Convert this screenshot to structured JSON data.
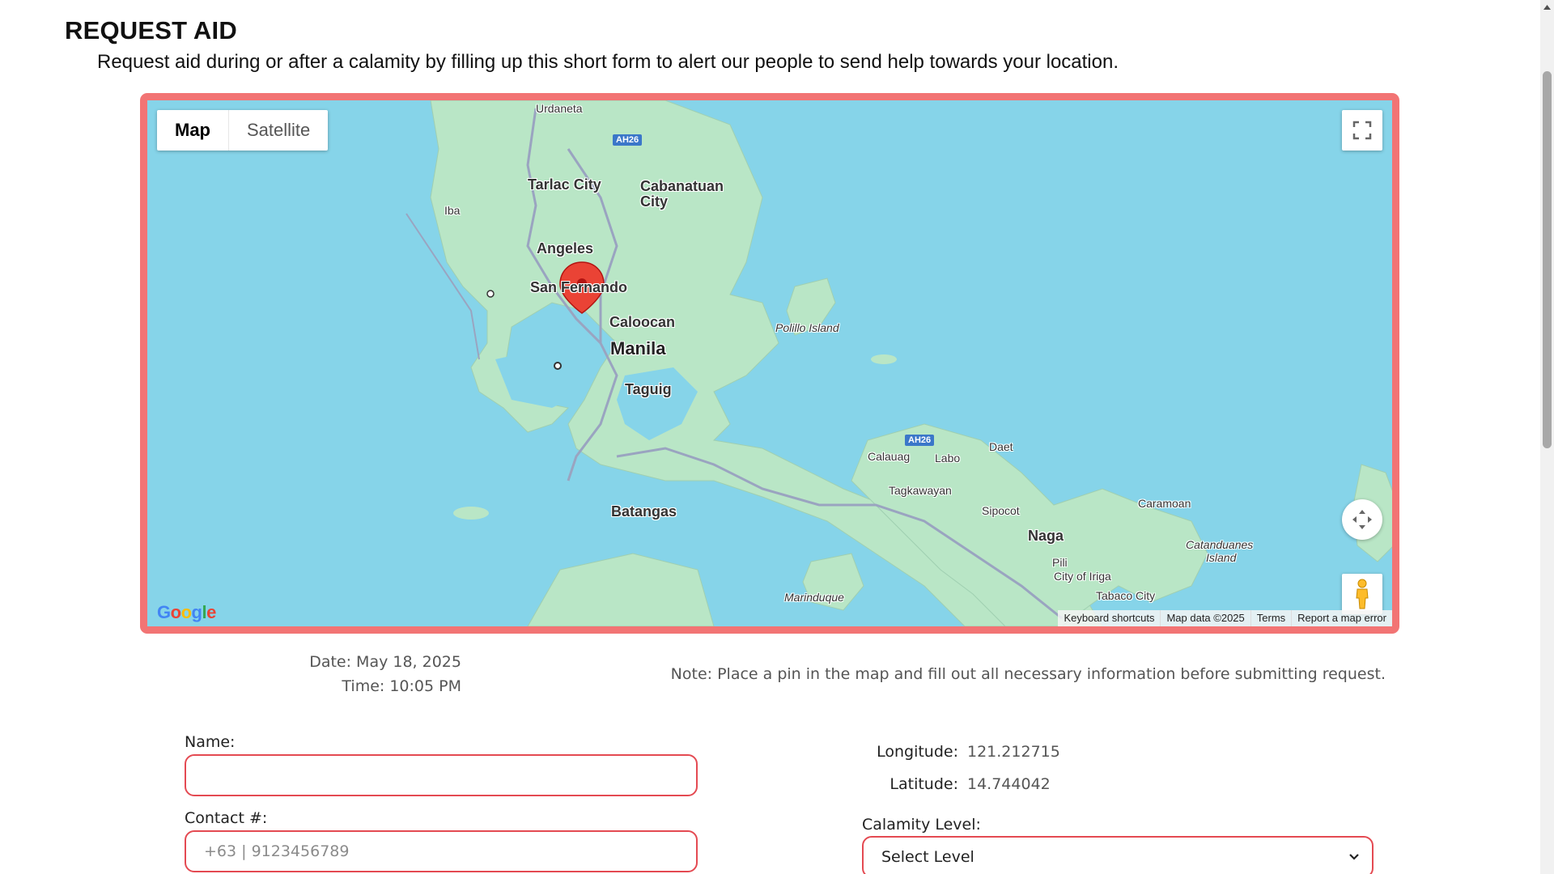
{
  "header": {
    "title": "REQUEST AID",
    "subtitle": "Request aid during or after a calamity by filling up this short form to alert our people to send help towards your location."
  },
  "map": {
    "map_type_options": [
      "Map",
      "Satellite"
    ],
    "selected_map_type": "Map",
    "place_labels": {
      "urdaneta": "Urdaneta",
      "tarlac": "Tarlac City",
      "cabanatuan": "Cabanatuan",
      "cabanatuan2": "City",
      "iba": "Iba",
      "angeles": "Angeles",
      "san_fernando": "San Fernando",
      "caloocan": "Caloocan",
      "manila": "Manila",
      "taguig": "Taguig",
      "polillo": "Polillo Island",
      "calauag": "Calauag",
      "labo": "Labo",
      "daet": "Daet",
      "tagkawayan": "Tagkawayan",
      "sipocot": "Sipocot",
      "naga": "Naga",
      "pili": "Pili",
      "iriga": "City of Iriga",
      "tabaco": "Tabaco City",
      "caramoan": "Caramoan",
      "catanduanes1": "Catanduanes",
      "catanduanes2": "Island",
      "batangas": "Batangas",
      "marinduque": "Marinduque"
    },
    "highway_shields": {
      "north": "AH26",
      "east": "AH26"
    },
    "logo_text": "Google",
    "attribution": {
      "shortcuts": "Keyboard shortcuts",
      "data": "Map data ©2025",
      "terms": "Terms",
      "report": "Report a map error"
    },
    "icons": {
      "fullscreen": "fullscreen-icon",
      "camera": "camera-control-icon",
      "pegman": "pegman-icon",
      "marker": "map-pin-icon"
    },
    "colors": {
      "water": "#86d4e9",
      "land": "#b9e6c6",
      "frame": "#f27474",
      "pin": "#ea4335"
    }
  },
  "meta": {
    "date": "Date: May 18, 2025",
    "time": "Time: 10:05 PM",
    "note": "Note: Place a pin in the map and fill out all necessary information before submitting request."
  },
  "form": {
    "name_label": "Name:",
    "name_value": "",
    "contact_label": "Contact #:",
    "contact_placeholder": "+63 | 9123456789",
    "longitude_label": "Longitude:",
    "longitude_value": "121.212715",
    "latitude_label": "Latitude:",
    "latitude_value": "14.744042",
    "calamity_label": "Calamity Level:",
    "calamity_selected": "Select Level"
  }
}
